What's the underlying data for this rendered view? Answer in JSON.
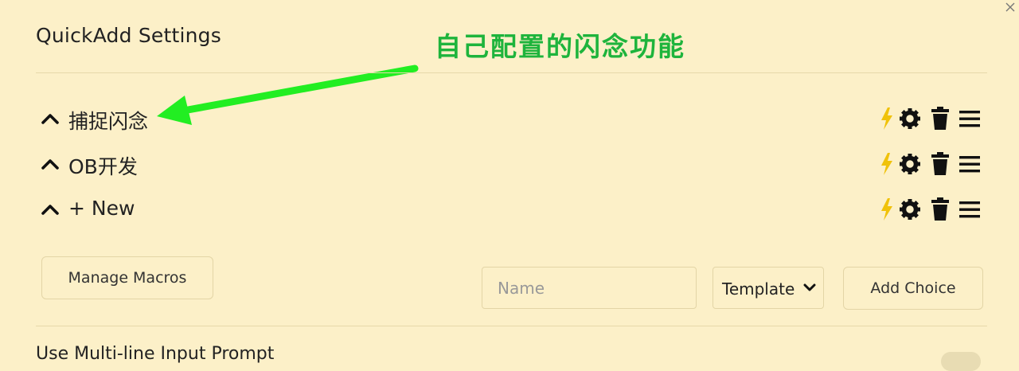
{
  "modal": {
    "title": "QuickAdd Settings",
    "close_icon": "close-icon"
  },
  "annotation": {
    "text": "自己配置的闪念功能",
    "color": "#1eb43c"
  },
  "choices": [
    {
      "name": "捕捉闪念"
    },
    {
      "name": "OB开发"
    },
    {
      "name": "+ New"
    }
  ],
  "row_icons": [
    "lightning-icon",
    "gear-icon",
    "trash-icon",
    "drag-handle-icon"
  ],
  "colors": {
    "background": "#fcf0c8",
    "lightning": "#f0c20a",
    "arrow": "#22ee22"
  },
  "footer": {
    "manage_macros_label": "Manage Macros",
    "name_placeholder": "Name",
    "type_select_value": "Template",
    "add_choice_label": "Add Choice"
  },
  "settings": {
    "multiline_label": "Use Multi-line Input Prompt"
  }
}
